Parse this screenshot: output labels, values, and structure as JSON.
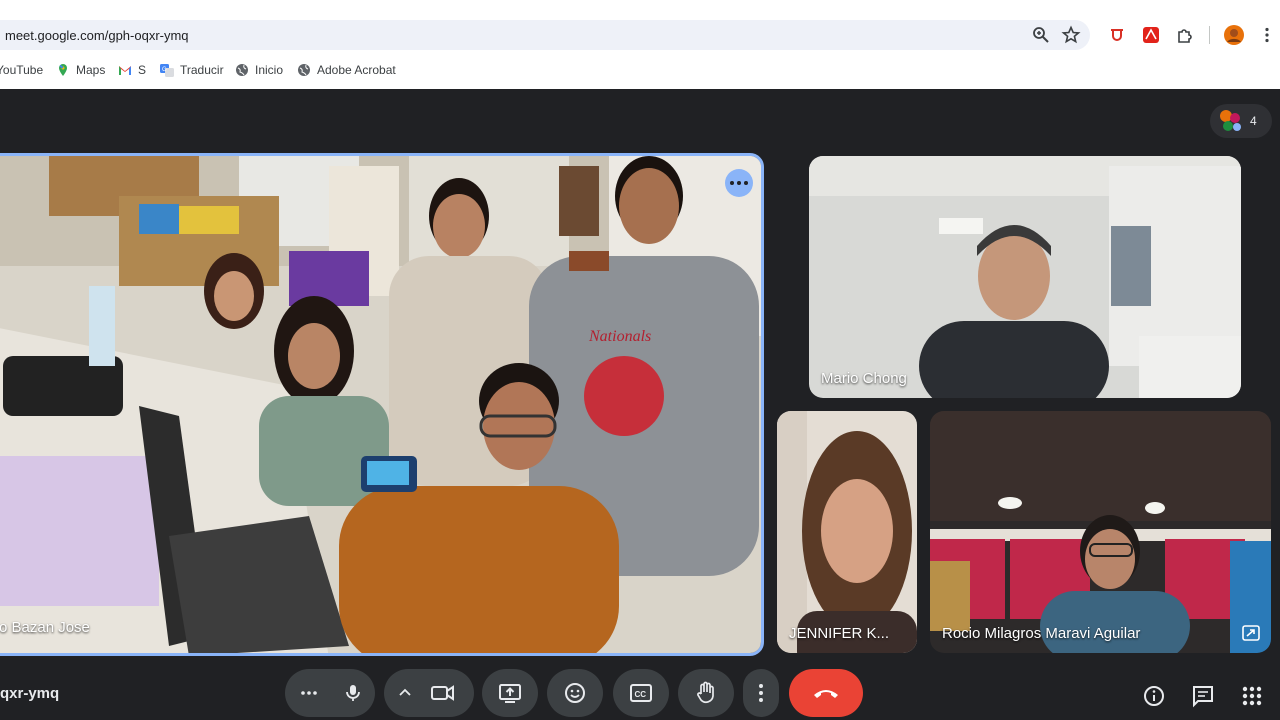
{
  "browser": {
    "url": "meet.google.com/gph-oqxr-ymq",
    "bookmarks": [
      {
        "label": "YouTube",
        "icon": "youtube-icon"
      },
      {
        "label": "Maps",
        "icon": "maps-pin-icon"
      },
      {
        "label": "S",
        "icon": "gmail-icon"
      },
      {
        "label": "Traducir",
        "icon": "translate-icon"
      },
      {
        "label": "Inicio",
        "icon": "globe-icon"
      },
      {
        "label": "Adobe Acrobat",
        "icon": "globe-icon"
      }
    ],
    "toolbar_icons": [
      "zoom-icon",
      "star-icon",
      "extension-red-icon",
      "adobe-icon",
      "puzzle-icon",
      "profile-avatar",
      "kebab-menu-icon"
    ]
  },
  "meet": {
    "participant_count": "4",
    "meeting_code": "qxr-ymq",
    "tiles": [
      {
        "id": "main",
        "name": "o Bazan Jose",
        "pinned": true
      },
      {
        "id": "mario",
        "name": "Mario Chong"
      },
      {
        "id": "jennifer",
        "name": "JENNIFER K..."
      },
      {
        "id": "rocio",
        "name": "Rocio Milagros Maravi Aguilar"
      }
    ],
    "controls": [
      "more-options",
      "microphone",
      "chevron-up",
      "camera",
      "present-screen",
      "emoji-reactions",
      "captions",
      "raise-hand",
      "more-actions",
      "leave-call"
    ],
    "right_controls": [
      "meeting-info",
      "chat",
      "activities"
    ]
  },
  "colors": {
    "accent": "#8ab4f8",
    "hangup": "#ea4335",
    "stage_bg": "#202124",
    "control_bg": "#3c4043"
  }
}
